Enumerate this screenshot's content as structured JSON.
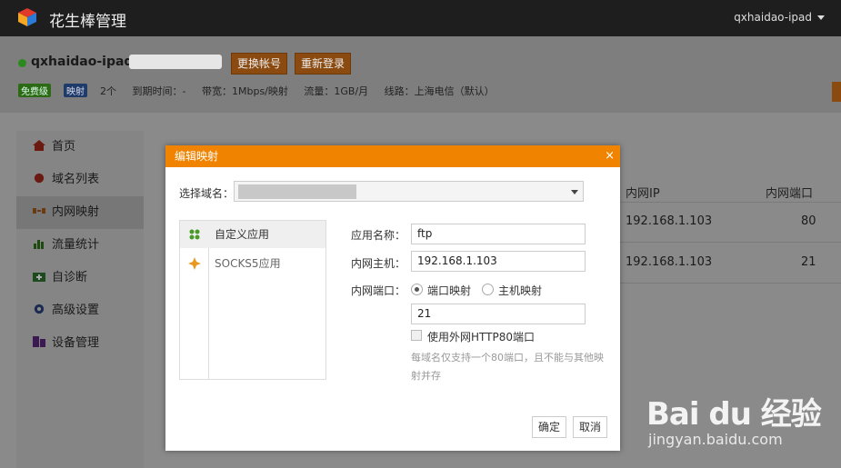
{
  "header": {
    "title": "花生棒管理",
    "user": "qxhaidao-ipad"
  },
  "account": {
    "name": "qxhaidao-ipad",
    "switch_account": "更换帐号",
    "relogin": "重新登录",
    "badge_free": "免费级",
    "badge_map": "映射",
    "map_count": "2个",
    "expire": "到期时间：-",
    "bandwidth": "带宽：1Mbps/映射",
    "traffic": "流量：1GB/月",
    "line": "线路：上海电信（默认）"
  },
  "sidebar": {
    "items": [
      {
        "label": "首页",
        "icon": "home-icon"
      },
      {
        "label": "域名列表",
        "icon": "globe-icon"
      },
      {
        "label": "内网映射",
        "icon": "mapping-icon"
      },
      {
        "label": "流量统计",
        "icon": "bar-chart-icon"
      },
      {
        "label": "自诊断",
        "icon": "medkit-icon"
      },
      {
        "label": "高级设置",
        "icon": "gear-icon"
      },
      {
        "label": "设备管理",
        "icon": "device-icon"
      }
    ]
  },
  "table": {
    "headers": {
      "ip": "内网IP",
      "port": "内网端口"
    },
    "rows": [
      {
        "ip": "192.168.1.103",
        "port": "80"
      },
      {
        "ip": "192.168.1.103",
        "port": "21"
      }
    ]
  },
  "dialog": {
    "title": "编辑映射",
    "close": "×",
    "domain_label": "选择域名：",
    "apps": [
      {
        "label": "自定义应用",
        "icon": "custom-app-icon"
      },
      {
        "label": "SOCKS5应用",
        "icon": "socks5-icon"
      }
    ],
    "app_name_label": "应用名称：",
    "app_name_value": "ftp",
    "host_label": "内网主机：",
    "host_value": "192.168.1.103",
    "port_label": "内网端口：",
    "radio_port": "端口映射",
    "radio_host": "主机映射",
    "port_value": "21",
    "use_http80": "使用外网HTTP80端口",
    "hint": "每域名仅支持一个80端口，且不能与其他映射并存",
    "ok": "确定",
    "cancel": "取消"
  },
  "watermark": {
    "logo": "Bai du 经验",
    "url": "jingyan.baidu.com"
  },
  "colors": {
    "accent": "#f08300",
    "topbar": "#1e1e1e",
    "overlay": "#8a8a8a"
  }
}
